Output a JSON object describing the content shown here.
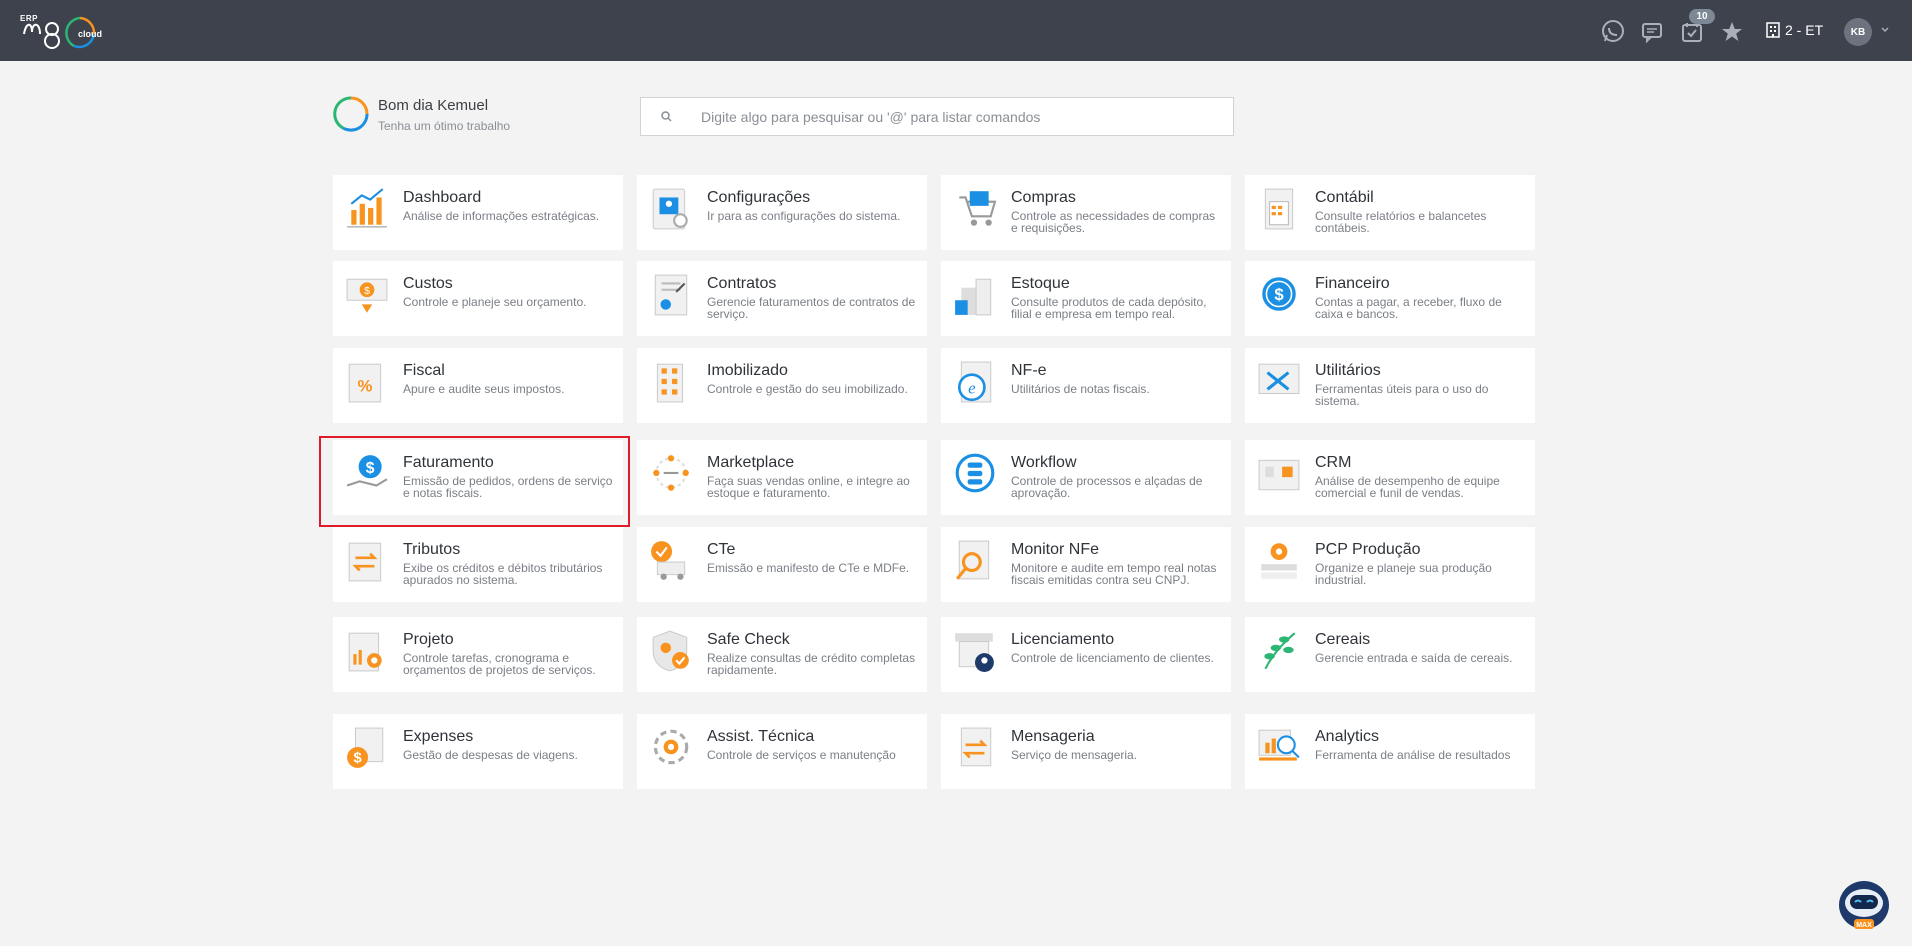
{
  "header": {
    "logo_prefix": "ERP",
    "logo_text": "m8",
    "logo_suffix": "cloud",
    "notification_count": "10",
    "company": "2 - ET",
    "user_initials": "KB",
    "icons": [
      "whatsapp-icon",
      "chat-icon",
      "tasks-icon",
      "star-icon",
      "building-icon",
      "chevron-down-icon"
    ]
  },
  "greeting": {
    "title": "Bom dia Kemuel",
    "subtitle": "Tenha um ótimo trabalho"
  },
  "search": {
    "placeholder": "Digite algo para pesquisar ou '@' para listar comandos"
  },
  "modules": [
    {
      "title": "Dashboard",
      "desc": "Análise de informações estratégicas."
    },
    {
      "title": "Configurações",
      "desc": "Ir para as configurações do sistema."
    },
    {
      "title": "Compras",
      "desc": "Controle as necessidades de compras e requisições."
    },
    {
      "title": "Contábil",
      "desc": "Consulte relatórios e balancetes contábeis."
    },
    {
      "title": "Custos",
      "desc": "Controle e planeje seu orçamento."
    },
    {
      "title": "Contratos",
      "desc": "Gerencie faturamentos de contratos de serviço."
    },
    {
      "title": "Estoque",
      "desc": "Consulte produtos de cada depósito, filial e empresa em tempo real."
    },
    {
      "title": "Financeiro",
      "desc": "Contas a pagar, a receber, fluxo de caixa e bancos."
    },
    {
      "title": "Fiscal",
      "desc": "Apure e audite seus impostos."
    },
    {
      "title": "Imobilizado",
      "desc": "Controle e gestão do seu imobilizado."
    },
    {
      "title": "NF-e",
      "desc": "Utilitários de notas fiscais."
    },
    {
      "title": "Utilitários",
      "desc": "Ferramentas úteis para o uso do sistema."
    },
    {
      "title": "Faturamento",
      "desc": "Emissão de pedidos, ordens de serviço e notas fiscais."
    },
    {
      "title": "Marketplace",
      "desc": "Faça suas vendas online, e integre ao estoque e faturamento."
    },
    {
      "title": "Workflow",
      "desc": "Controle de processos e alçadas de aprovação."
    },
    {
      "title": "CRM",
      "desc": "Análise de desempenho de equipe comercial e funil de vendas."
    },
    {
      "title": "Tributos",
      "desc": "Exibe os créditos e débitos tributários apurados no sistema."
    },
    {
      "title": "CTe",
      "desc": "Emissão e manifesto de CTe e MDFe."
    },
    {
      "title": "Monitor NFe",
      "desc": "Monitore e audite em tempo real notas fiscais emitidas contra seu CNPJ."
    },
    {
      "title": "PCP Produção",
      "desc": "Organize e planeje sua produção industrial."
    },
    {
      "title": "Projeto",
      "desc": "Controle tarefas, cronograma e orçamentos de projetos de serviços."
    },
    {
      "title": "Safe Check",
      "desc": "Realize consultas de crédito completas rapidamente."
    },
    {
      "title": "Licenciamento",
      "desc": "Controle de licenciamento de clientes."
    },
    {
      "title": "Cereais",
      "desc": "Gerencie entrada e saída de cereais."
    },
    {
      "title": "Expenses",
      "desc": "Gestão de despesas de viagens."
    },
    {
      "title": "Assist. Técnica",
      "desc": "Controle de serviços e manutenção"
    },
    {
      "title": "Mensageria",
      "desc": "Serviço de mensageria."
    },
    {
      "title": "Analytics",
      "desc": "Ferramenta de análise de resultados"
    }
  ],
  "assistant": {
    "label": "MAX"
  },
  "colors": {
    "topbar": "#3d424c",
    "accent_orange": "#f7931e",
    "accent_blue": "#1a8fe3",
    "highlight": "#e0192b"
  }
}
